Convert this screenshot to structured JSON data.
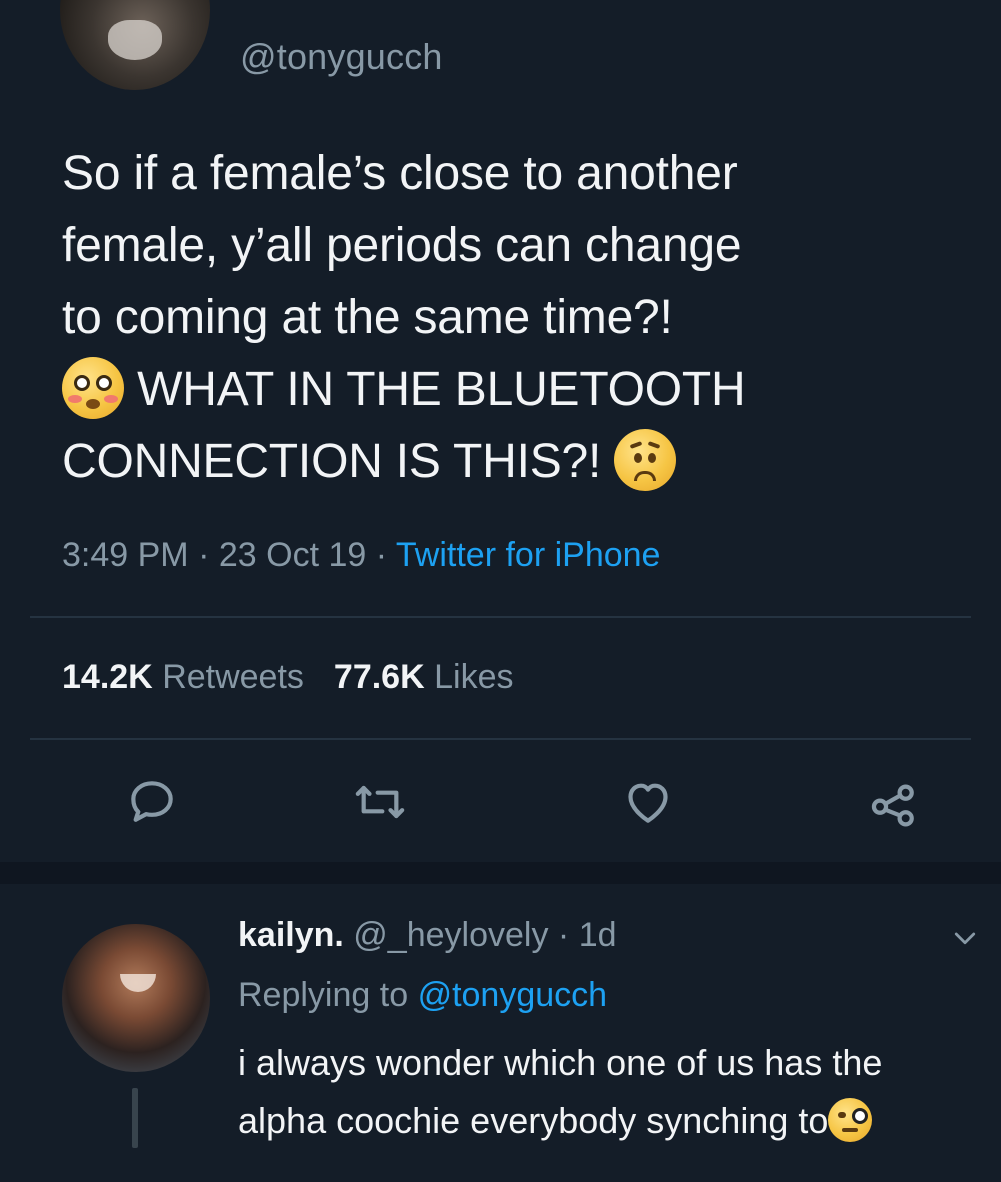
{
  "tweet": {
    "handle": "@tonygucch",
    "lines": [
      "So if a female’s close to another",
      "female, y’all periods can change",
      "to coming at the same time?!",
      "WHAT IN THE BLUETOOTH",
      "CONNECTION IS THIS?!"
    ],
    "time": "3:49 PM",
    "date": "23 Oct 19",
    "source": "Twitter for iPhone",
    "retweets_count": "14.2K",
    "retweets_label": "Retweets",
    "likes_count": "77.6K",
    "likes_label": "Likes",
    "emoji_1": "flushed-face-emoji",
    "emoji_2": "worried-face-emoji"
  },
  "actions": {
    "reply": "reply-icon",
    "retweet": "retweet-icon",
    "like": "heart-icon",
    "share": "share-icon"
  },
  "reply": {
    "name": "kailyn.",
    "handle": "@_heylovely",
    "age": "1d",
    "replying_prefix": "Replying to",
    "replying_to": "@tonygucch",
    "lines": [
      "i always wonder which one of us has the",
      "alpha coochie everybody synching to"
    ],
    "emoji": "face-with-monocle-emoji"
  },
  "colors": {
    "background": "#141d28",
    "text": "#f2f4f6",
    "muted": "#8899a6",
    "accent": "#1da1f2"
  }
}
